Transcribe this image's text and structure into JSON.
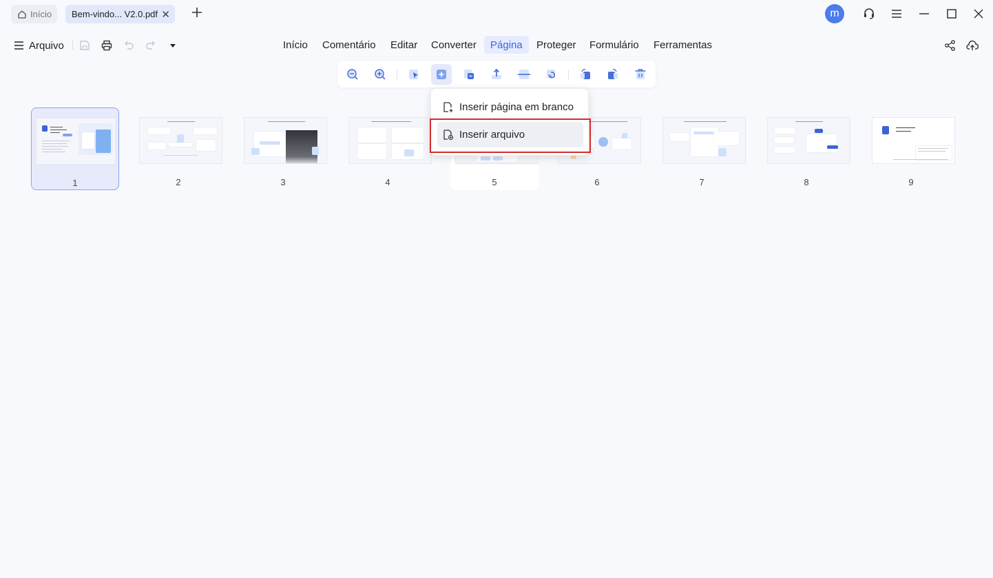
{
  "tabs": {
    "home_label": "Início",
    "doc_label": "Bem-vindo... V2.0.pdf",
    "close_glyph": "✕"
  },
  "user": {
    "avatar_letter": "m"
  },
  "file_menu": {
    "label": "Arquivo"
  },
  "main_menu": {
    "items": [
      "Início",
      "Comentário",
      "Editar",
      "Converter",
      "Página",
      "Proteger",
      "Formulário",
      "Ferramentas"
    ],
    "active": "Página"
  },
  "page_toolbar": {
    "icons": [
      "zoom-out-icon",
      "zoom-in-icon",
      "select-icon",
      "insert-page-icon",
      "replace-page-icon",
      "extract-page-icon",
      "split-page-icon",
      "crop-page-icon",
      "rotate-left-icon",
      "rotate-right-icon",
      "delete-page-icon"
    ]
  },
  "insert_dropdown": {
    "blank_page": "Inserir página em branco",
    "insert_file": "Inserir arquivo"
  },
  "thumbnails": {
    "pages": [
      "1",
      "2",
      "3",
      "4",
      "5",
      "6",
      "7",
      "8",
      "9"
    ],
    "selected_page": "1"
  },
  "colors": {
    "accent": "#3a63e8",
    "avatar": "#4b7bec",
    "highlight": "#d62b2b",
    "selected_bg": "#e6eafb"
  }
}
